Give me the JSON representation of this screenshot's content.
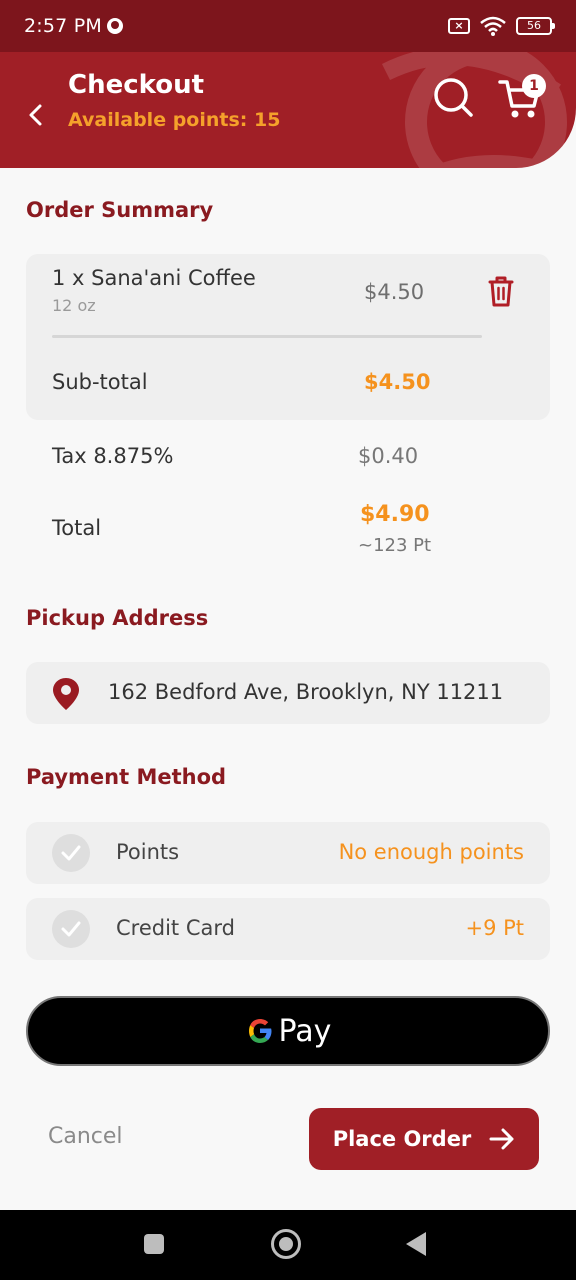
{
  "status_bar": {
    "time": "2:57 PM",
    "battery": "56"
  },
  "header": {
    "title": "Checkout",
    "available_points": "Available points: 15",
    "cart_count": "1"
  },
  "order_summary": {
    "title": "Order Summary",
    "item": {
      "name": "1 x Sana'ani Coffee",
      "size": "12 oz",
      "price": "$4.50"
    },
    "subtotal_label": "Sub-total",
    "subtotal_value": "$4.50",
    "tax_label": "Tax 8.875%",
    "tax_value": "$0.40",
    "total_label": "Total",
    "total_value": "$4.90",
    "total_points": "~123 Pt"
  },
  "pickup": {
    "title": "Pickup Address",
    "address": "162 Bedford Ave, Brooklyn, NY 11211"
  },
  "payment": {
    "title": "Payment Method",
    "methods": [
      {
        "label": "Points",
        "note": "No enough points"
      },
      {
        "label": "Credit Card",
        "note": "+9 Pt"
      }
    ],
    "gpay_label": "Pay"
  },
  "actions": {
    "cancel": "Cancel",
    "place_order": "Place Order"
  },
  "colors": {
    "brand": "#a01f26",
    "accent": "#f5921e",
    "dark_brand": "#7d151c"
  }
}
